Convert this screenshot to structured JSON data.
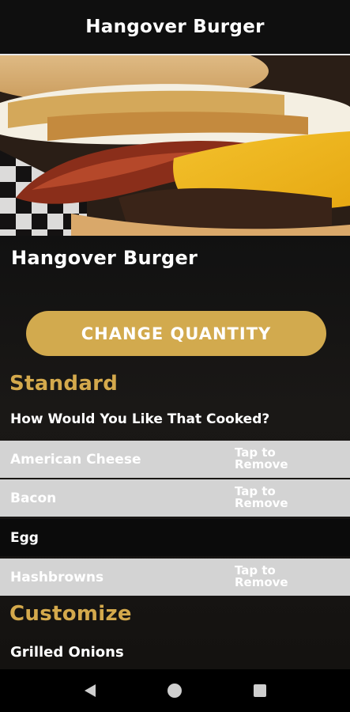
{
  "header": {
    "title": "Hangover Burger"
  },
  "item": {
    "name": "Hangover Burger",
    "change_quantity_label": "CHANGE QUANTITY"
  },
  "standard": {
    "title": "Standard",
    "question": "How Would You Like That Cooked?",
    "ingredients": [
      {
        "label": "American Cheese",
        "action": "Tap to Remove"
      },
      {
        "label": "Bacon",
        "action": "Tap to Remove"
      },
      {
        "label": "Egg"
      },
      {
        "label": "Hashbrowns",
        "action": "Tap to Remove"
      }
    ]
  },
  "customize": {
    "title": "Customize",
    "first_option": "Grilled Onions"
  },
  "navigation": {
    "icons": [
      "back-icon",
      "home-icon",
      "recents-icon"
    ]
  },
  "colors": {
    "accent": "#d2aa4e",
    "section_title": "#d4a94c",
    "removable_row": "#d3d3d3"
  }
}
